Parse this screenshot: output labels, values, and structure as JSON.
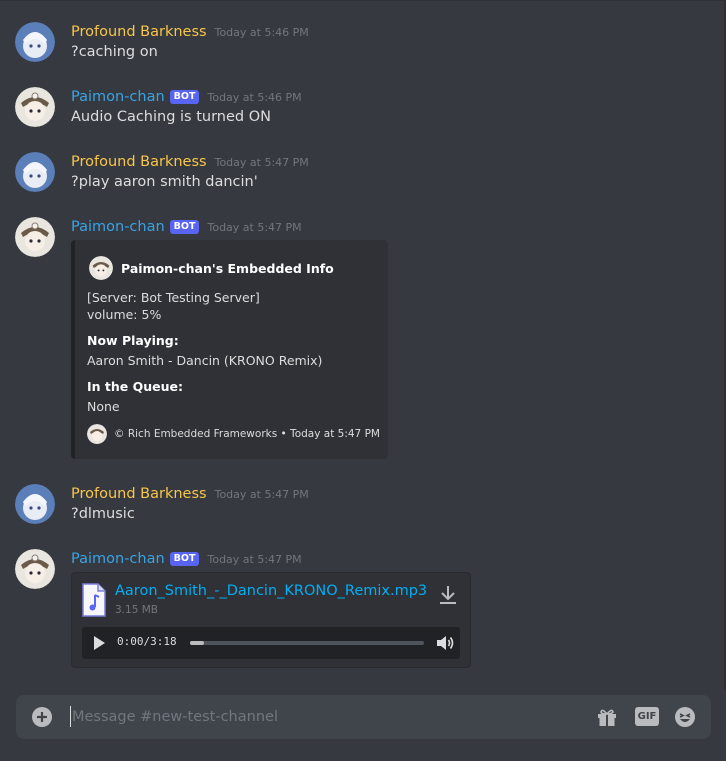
{
  "channel": {
    "composer_placeholder": "Message #new-test-channel",
    "composer_value": ""
  },
  "messages": [
    {
      "author": "Profound Barkness",
      "bot": false,
      "timestamp": "Today at 5:46 PM",
      "content": "?caching on"
    },
    {
      "author": "Paimon-chan",
      "bot": true,
      "bot_tag": "BOT",
      "timestamp": "Today at 5:46 PM",
      "content": "Audio Caching is turned ON"
    },
    {
      "author": "Profound Barkness",
      "bot": false,
      "timestamp": "Today at 5:47 PM",
      "content": "?play aaron smith dancin'"
    },
    {
      "author": "Paimon-chan",
      "bot": true,
      "bot_tag": "BOT",
      "timestamp": "Today at 5:47 PM",
      "embed": {
        "author": "Paimon-chan's Embedded Info",
        "server_line": "[Server: Bot Testing Server]",
        "volume_line": "volume: 5%",
        "now_playing_label": "Now Playing:",
        "now_playing": "Aaron Smith - Dancin (KRONO Remix)",
        "queue_label": "In the Queue:",
        "queue": "None",
        "footer": "© Rich Embedded Frameworks • Today at 5:47 PM"
      }
    },
    {
      "author": "Profound Barkness",
      "bot": false,
      "timestamp": "Today at 5:47 PM",
      "content": "?dlmusic"
    },
    {
      "author": "Paimon-chan",
      "bot": true,
      "bot_tag": "BOT",
      "timestamp": "Today at 5:47 PM",
      "attachment": {
        "filename": "Aaron_Smith_-_Dancin_KRONO_Remix.mp3",
        "size": "3.15 MB",
        "current_time": "0:00",
        "time_separator": "/",
        "duration": "3:18",
        "progress_fraction": 0.06
      }
    }
  ],
  "icons": {
    "composer_add": "plus-circle-icon",
    "gift": "gift-icon",
    "gif": "gif-icon",
    "gif_label": "GIF",
    "emoji": "emoji-icon",
    "download": "download-icon",
    "play": "play-icon",
    "volume": "volume-icon",
    "audio_file": "audio-file-icon"
  },
  "colors": {
    "background": "#36393f",
    "user_color_profound": "#f7c64a",
    "user_color_paimon": "#3aa3e4",
    "bot_tag": "#5865f2",
    "link": "#00aff4",
    "embed_bg": "#2f3136",
    "composer_bg": "#40444b"
  }
}
